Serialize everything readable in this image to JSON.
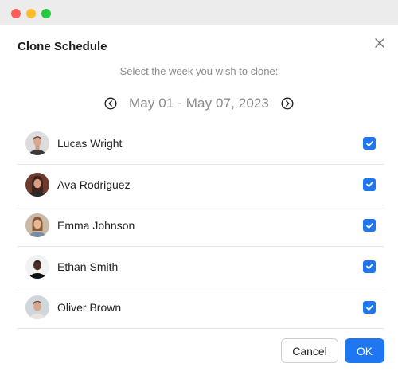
{
  "window": {
    "controls": [
      "close",
      "minimize",
      "maximize"
    ]
  },
  "dialog": {
    "title": "Clone Schedule",
    "close_icon": "close-icon",
    "subtitle": "Select the week you wish to clone:",
    "week": {
      "label": "May 01 - May 07, 2023",
      "prev_icon": "chevron-left-circle-icon",
      "next_icon": "chevron-right-circle-icon"
    },
    "people": [
      {
        "name": "Lucas Wright",
        "checked": true
      },
      {
        "name": "Ava Rodriguez",
        "checked": true
      },
      {
        "name": "Emma Johnson",
        "checked": true
      },
      {
        "name": "Ethan Smith",
        "checked": true
      },
      {
        "name": "Oliver Brown",
        "checked": true
      }
    ],
    "buttons": {
      "cancel_label": "Cancel",
      "ok_label": "OK"
    }
  },
  "colors": {
    "accent": "#1e77f0",
    "muted_text": "#8a8a8a",
    "titlebar": "#ececec"
  }
}
